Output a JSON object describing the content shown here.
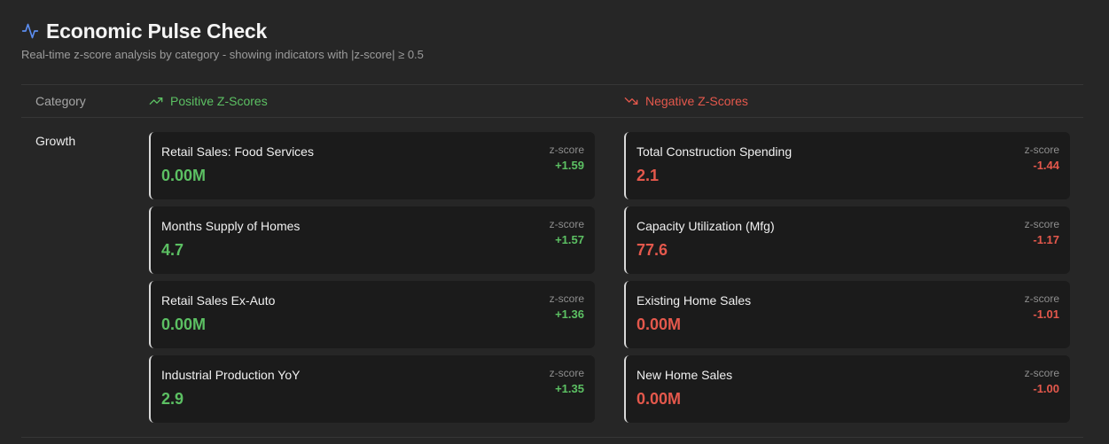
{
  "header": {
    "title": "Economic Pulse Check",
    "subtitle": "Real-time z-score analysis by category - showing indicators with |z-score| ≥ 0.5",
    "icon": "activity-icon"
  },
  "table": {
    "category_header": "Category",
    "positive_header": "Positive Z-Scores",
    "negative_header": "Negative Z-Scores",
    "positive_icon": "trending-up-icon",
    "negative_icon": "trending-down-icon"
  },
  "colors": {
    "positive": "#5cc063",
    "negative": "#e4584c",
    "accent": "#5b8def"
  },
  "rows": [
    {
      "category": "Growth",
      "positive": [
        {
          "name": "Retail Sales: Food Services",
          "value": "0.00M",
          "z_label": "z-score",
          "z": "+1.59"
        },
        {
          "name": "Months Supply of Homes",
          "value": "4.7",
          "z_label": "z-score",
          "z": "+1.57"
        },
        {
          "name": "Retail Sales Ex-Auto",
          "value": "0.00M",
          "z_label": "z-score",
          "z": "+1.36"
        },
        {
          "name": "Industrial Production YoY",
          "value": "2.9",
          "z_label": "z-score",
          "z": "+1.35"
        }
      ],
      "negative": [
        {
          "name": "Total Construction Spending",
          "value": "2.1",
          "z_label": "z-score",
          "z": "-1.44"
        },
        {
          "name": "Capacity Utilization (Mfg)",
          "value": "77.6",
          "z_label": "z-score",
          "z": "-1.17"
        },
        {
          "name": "Existing Home Sales",
          "value": "0.00M",
          "z_label": "z-score",
          "z": "-1.01"
        },
        {
          "name": "New Home Sales",
          "value": "0.00M",
          "z_label": "z-score",
          "z": "-1.00"
        }
      ]
    }
  ]
}
